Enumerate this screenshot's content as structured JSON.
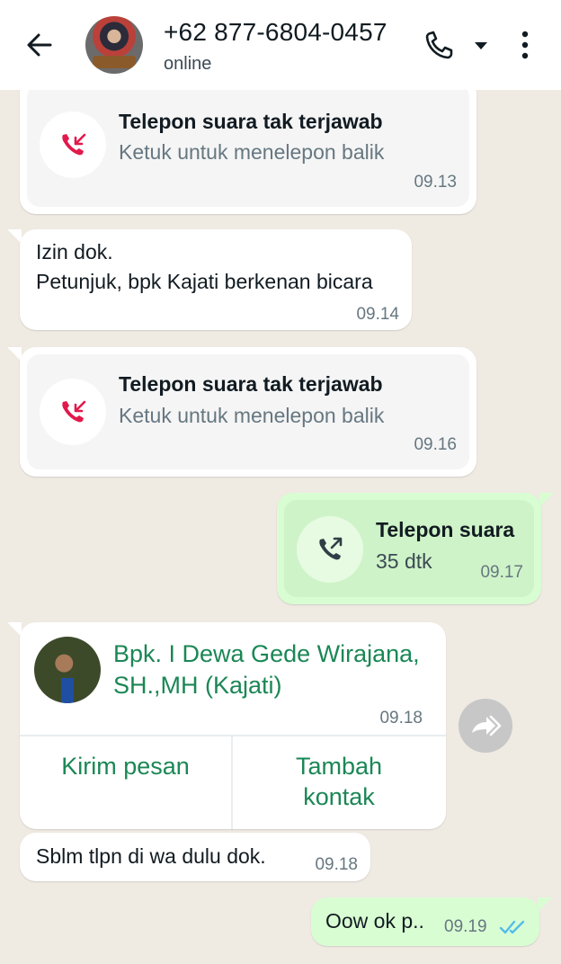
{
  "header": {
    "contact_name": "+62 877-6804-0457",
    "status": "online",
    "icons": {
      "back": "arrow-left-icon",
      "call": "phone-icon",
      "dropdown": "caret-down-icon",
      "menu": "kebab-menu-icon"
    }
  },
  "colors": {
    "chat_bg": "#efeae2",
    "incoming_bubble": "#ffffff",
    "outgoing_bubble": "#d9fdd3",
    "missed_call_red": "#e2194b",
    "contact_green": "#1b8755",
    "read_tick_blue": "#53bdeb"
  },
  "messages": [
    {
      "type": "missed_call",
      "direction": "in",
      "title": "Telepon suara tak terjawab",
      "subtitle": "Ketuk untuk menelepon balik",
      "time": "09.13",
      "icon": "missed-call-icon"
    },
    {
      "type": "text",
      "direction": "in",
      "lines": [
        "Izin dok.",
        "Petunjuk, bpk Kajati berkenan bicara"
      ],
      "time": "09.14"
    },
    {
      "type": "missed_call",
      "direction": "in",
      "title": "Telepon suara tak terjawab",
      "subtitle": "Ketuk untuk menelepon balik",
      "time": "09.16",
      "icon": "missed-call-icon"
    },
    {
      "type": "call",
      "direction": "out",
      "title": "Telepon suara",
      "duration": "35 dtk",
      "time": "09.17",
      "icon": "outgoing-call-icon"
    },
    {
      "type": "contact_card",
      "direction": "in",
      "name_lines": [
        "Bpk. I Dewa Gede Wirajana,",
        "SH.,MH (Kajati)"
      ],
      "time": "09.18",
      "actions": [
        "Kirim pesan",
        "Tambah kontak"
      ],
      "icon": "forward-icon"
    },
    {
      "type": "text",
      "direction": "in",
      "lines": [
        "Sblm tlpn di wa dulu dok."
      ],
      "time": "09.18"
    },
    {
      "type": "text",
      "direction": "out",
      "lines": [
        "Oow ok p.."
      ],
      "time": "09.19",
      "status_icon": "double-check-icon"
    }
  ]
}
